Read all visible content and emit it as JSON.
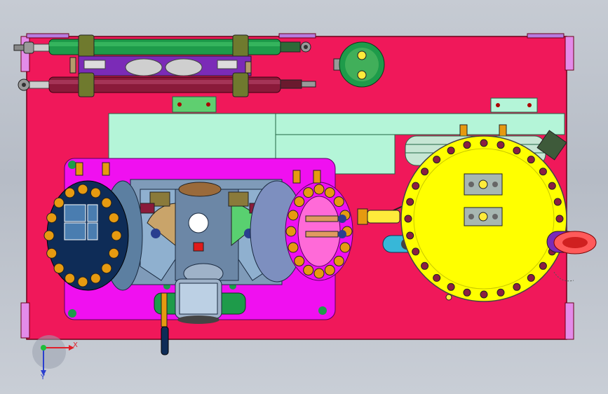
{
  "view": {
    "title": "",
    "background": "#c0c5ce"
  },
  "triad": {
    "x_label": "X",
    "y_label": "Y",
    "x_color": "#e0202a",
    "y_color": "#2a3fcf",
    "origin_color": "#1dbf3a"
  },
  "colors": {
    "base_plate": "#f0185a",
    "plate_edge": "#7a0020",
    "cover_plate": "#b4f5d8",
    "lavender_block": "#e38be9",
    "magenta": "#f010f0",
    "yellow_flange": "#ffff00",
    "bolt": "#8a1f42",
    "green_cylinder": "#1e9b4a",
    "maroon_cylinder": "#8a1a3a",
    "olive_bracket": "#6f7a2e",
    "purple_block": "#7b2bb7",
    "steel": "#9fb2c8",
    "navy_flange": "#0e2c57",
    "orange_bolt": "#e69a10",
    "cyan_clamp": "#37b7d8"
  },
  "components": [
    "base-plate",
    "upper-cylinder",
    "lower-cylinder",
    "sensor-disc",
    "central-hub",
    "left-flange",
    "right-flange",
    "large-yellow-flange",
    "bottom-motor"
  ]
}
